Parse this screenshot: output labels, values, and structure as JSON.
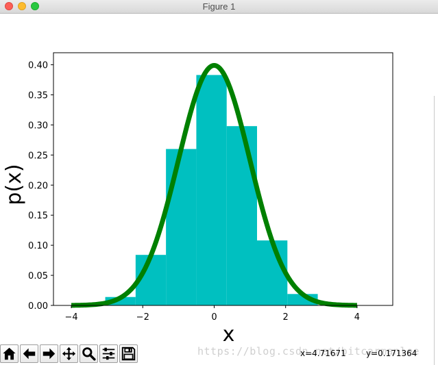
{
  "window": {
    "title": "Figure 1",
    "colors": {
      "close": "#fc5f57",
      "minimize": "#fdbc2e",
      "zoom": "#28c840"
    }
  },
  "chart_data": {
    "type": "bar",
    "title": "",
    "xlabel": "x",
    "ylabel": "p(x)",
    "xlim": [
      -4.5,
      5.0
    ],
    "ylim": [
      0.0,
      0.42
    ],
    "xticks": [
      -4,
      -2,
      0,
      2,
      4
    ],
    "xtick_labels": [
      "−4",
      "−2",
      "0",
      "2",
      "4"
    ],
    "yticks": [
      0.0,
      0.05,
      0.1,
      0.15,
      0.2,
      0.25,
      0.3,
      0.35,
      0.4
    ],
    "ytick_labels": [
      "0.00",
      "0.05",
      "0.10",
      "0.15",
      "0.20",
      "0.25",
      "0.30",
      "0.35",
      "0.40"
    ],
    "grid": false,
    "histogram": {
      "color": "#00c0c0",
      "bins": [
        {
          "x0": -3.05,
          "x1": -2.2,
          "value": 0.014
        },
        {
          "x0": -2.2,
          "x1": -1.35,
          "value": 0.084
        },
        {
          "x0": -1.35,
          "x1": -0.5,
          "value": 0.26
        },
        {
          "x0": -0.5,
          "x1": 0.35,
          "value": 0.383
        },
        {
          "x0": 0.35,
          "x1": 1.2,
          "value": 0.298
        },
        {
          "x0": 1.2,
          "x1": 2.05,
          "value": 0.108
        },
        {
          "x0": 2.05,
          "x1": 2.9,
          "value": 0.019
        }
      ]
    },
    "curve": {
      "color": "#008000",
      "function": "standard normal pdf",
      "x_range": [
        -4.0,
        4.0
      ]
    }
  },
  "toolbar": {
    "buttons": [
      {
        "name": "home-button",
        "icon": "home-icon"
      },
      {
        "name": "back-button",
        "icon": "arrow-left-icon"
      },
      {
        "name": "forward-button",
        "icon": "arrow-right-icon"
      },
      {
        "name": "pan-button",
        "icon": "move-icon"
      },
      {
        "name": "zoom-button",
        "icon": "magnifier-icon"
      },
      {
        "name": "subplots-button",
        "icon": "sliders-icon"
      },
      {
        "name": "save-button",
        "icon": "floppy-disk-icon"
      }
    ],
    "watermark": "https://blog.csdn.net/bitcarmanlee",
    "coord_x": "x=4.71671",
    "coord_y": "y=0.171364"
  }
}
